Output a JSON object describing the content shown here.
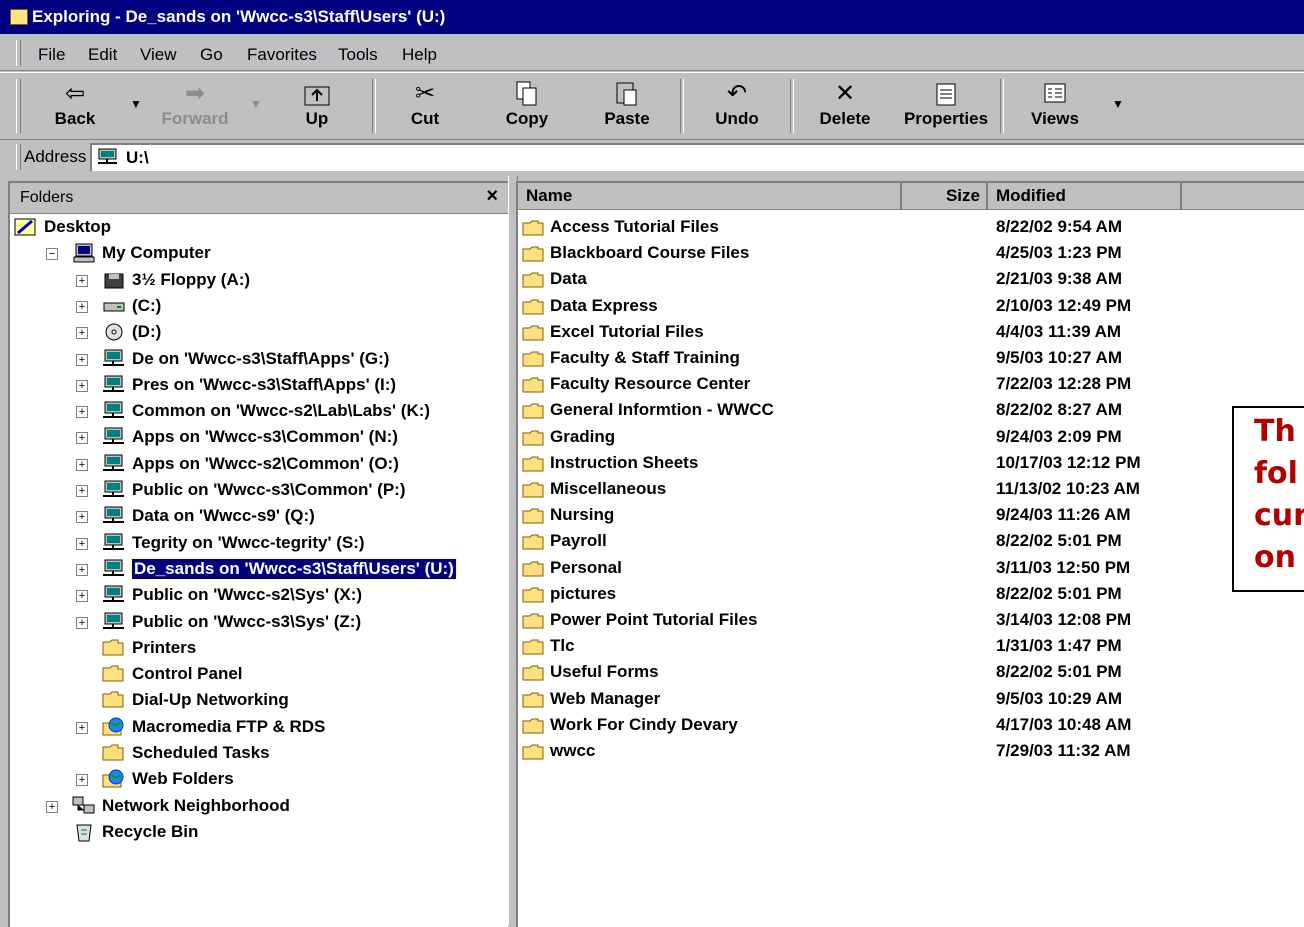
{
  "window": {
    "title": "Exploring - De_sands on 'Wwcc-s3\\Staff\\Users' (U:)"
  },
  "menu": [
    "File",
    "Edit",
    "View",
    "Go",
    "Favorites",
    "Tools",
    "Help"
  ],
  "toolbar": {
    "back": "Back",
    "forward": "Forward",
    "up": "Up",
    "cut": "Cut",
    "copy": "Copy",
    "paste": "Paste",
    "undo": "Undo",
    "delete": "Delete",
    "properties": "Properties",
    "views": "Views"
  },
  "address": {
    "label": "Address",
    "value": "U:\\"
  },
  "folders_pane": {
    "title": "Folders",
    "close": "×",
    "tree": [
      {
        "label": "Desktop",
        "icon": "desktop-icon"
      },
      {
        "label": "My Computer",
        "icon": "computer-icon",
        "toggle": "−"
      },
      {
        "label": "3½ Floppy (A:)",
        "icon": "floppy-icon",
        "toggle": "+"
      },
      {
        "label": "(C:)",
        "icon": "drive-icon",
        "toggle": "+"
      },
      {
        "label": "(D:)",
        "icon": "cdrom-icon",
        "toggle": "+"
      },
      {
        "label": "De on 'Wwcc-s3\\Staff\\Apps' (G:)",
        "icon": "network-drive-icon",
        "toggle": "+"
      },
      {
        "label": "Pres on 'Wwcc-s3\\Staff\\Apps' (I:)",
        "icon": "network-drive-icon",
        "toggle": "+"
      },
      {
        "label": "Common on 'Wwcc-s2\\Lab\\Labs' (K:)",
        "icon": "network-drive-icon",
        "toggle": "+"
      },
      {
        "label": "Apps on 'Wwcc-s3\\Common' (N:)",
        "icon": "network-drive-icon",
        "toggle": "+"
      },
      {
        "label": "Apps on 'Wwcc-s2\\Common' (O:)",
        "icon": "network-drive-icon",
        "toggle": "+"
      },
      {
        "label": "Public on 'Wwcc-s3\\Common' (P:)",
        "icon": "network-drive-icon",
        "toggle": "+"
      },
      {
        "label": "Data on 'Wwcc-s9' (Q:)",
        "icon": "network-drive-icon",
        "toggle": "+"
      },
      {
        "label": "Tegrity on 'Wwcc-tegrity' (S:)",
        "icon": "network-drive-icon",
        "toggle": "+"
      },
      {
        "label": "De_sands on 'Wwcc-s3\\Staff\\Users' (U:)",
        "icon": "network-drive-icon",
        "toggle": "+",
        "selected": true
      },
      {
        "label": "Public on 'Wwcc-s2\\Sys' (X:)",
        "icon": "network-drive-icon",
        "toggle": "+"
      },
      {
        "label": "Public on 'Wwcc-s3\\Sys' (Z:)",
        "icon": "network-drive-icon",
        "toggle": "+"
      },
      {
        "label": "Printers",
        "icon": "printers-folder-icon"
      },
      {
        "label": "Control Panel",
        "icon": "control-panel-icon"
      },
      {
        "label": "Dial-Up Networking",
        "icon": "dialup-icon"
      },
      {
        "label": "Macromedia FTP & RDS",
        "icon": "ftp-icon",
        "toggle": "+"
      },
      {
        "label": "Scheduled Tasks",
        "icon": "scheduled-tasks-icon"
      },
      {
        "label": "Web Folders",
        "icon": "web-folders-icon",
        "toggle": "+"
      },
      {
        "label": "Network Neighborhood",
        "icon": "network-neighborhood-icon",
        "toggle": "+"
      },
      {
        "label": "Recycle Bin",
        "icon": "recycle-bin-icon"
      }
    ]
  },
  "file_list": {
    "columns": [
      "Name",
      "Size",
      "Modified"
    ],
    "rows": [
      {
        "name": "Access Tutorial Files",
        "modified": "8/22/02 9:54 AM"
      },
      {
        "name": "Blackboard Course Files",
        "modified": "4/25/03 1:23 PM"
      },
      {
        "name": "Data",
        "modified": "2/21/03 9:38 AM"
      },
      {
        "name": "Data Express",
        "modified": "2/10/03 12:49 PM"
      },
      {
        "name": "Excel Tutorial Files",
        "modified": "4/4/03 11:39 AM"
      },
      {
        "name": "Faculty & Staff Training",
        "modified": "9/5/03 10:27 AM"
      },
      {
        "name": "Faculty Resource Center",
        "modified": "7/22/03 12:28 PM"
      },
      {
        "name": "General Informtion - WWCC",
        "modified": "8/22/02 8:27 AM"
      },
      {
        "name": "Grading",
        "modified": "9/24/03 2:09 PM"
      },
      {
        "name": "Instruction Sheets",
        "modified": "10/17/03 12:12 PM"
      },
      {
        "name": "Miscellaneous",
        "modified": "11/13/02 10:23 AM"
      },
      {
        "name": "Nursing",
        "modified": "9/24/03 11:26 AM"
      },
      {
        "name": "Payroll",
        "modified": "8/22/02 5:01 PM"
      },
      {
        "name": "Personal",
        "modified": "3/11/03 12:50 PM"
      },
      {
        "name": "pictures",
        "modified": "8/22/02 5:01 PM"
      },
      {
        "name": "Power Point Tutorial Files",
        "modified": "3/14/03 12:08 PM"
      },
      {
        "name": "Tlc",
        "modified": "1/31/03 1:47 PM"
      },
      {
        "name": "Useful Forms",
        "modified": "8/22/02 5:01 PM"
      },
      {
        "name": "Web Manager",
        "modified": "9/5/03 10:29 AM"
      },
      {
        "name": "Work For Cindy Devary",
        "modified": "4/17/03 10:48 AM"
      },
      {
        "name": "wwcc",
        "modified": "7/29/03 11:32 AM"
      }
    ]
  },
  "callout": {
    "lines": [
      "Th",
      "fol",
      "cur",
      "on"
    ]
  }
}
